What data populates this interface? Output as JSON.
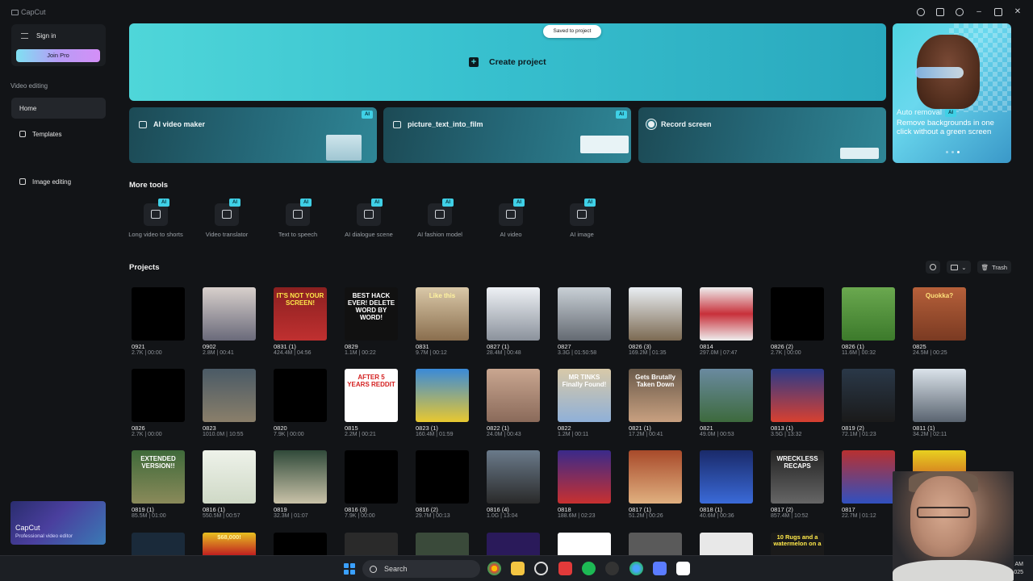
{
  "window": {
    "app_name": "CapCut"
  },
  "sidebar": {
    "sign_in": "Sign in",
    "join_pro": "Join Pro",
    "section_video": "Video editing",
    "items": [
      {
        "label": "Home"
      },
      {
        "label": "Templates"
      }
    ],
    "image_editing": "Image editing",
    "promo": {
      "title": "CapCut",
      "subtitle": "Professional video editor"
    }
  },
  "main": {
    "toast": "Saved to project",
    "create_project": "Create project",
    "features": [
      {
        "label": "AI video maker",
        "badge": "AI"
      },
      {
        "label": "picture_text_into_film",
        "badge": "AI"
      },
      {
        "label": "Record screen"
      }
    ],
    "hero": {
      "title": "Auto removal",
      "badge": "AI",
      "text": "Remove backgrounds in one click without a green screen"
    },
    "more_tools_title": "More tools",
    "tools": [
      {
        "label": "Long video to shorts",
        "badge": "AI",
        "icon": "film-icon"
      },
      {
        "label": "Video translator",
        "badge": "AI",
        "icon": "translate-icon"
      },
      {
        "label": "Text to speech",
        "badge": "AI",
        "icon": "speech-icon"
      },
      {
        "label": "AI dialogue scene",
        "badge": "AI",
        "icon": "dialogue-icon"
      },
      {
        "label": "AI fashion model",
        "badge": "AI",
        "icon": "shirt-icon"
      },
      {
        "label": "AI video",
        "badge": "AI",
        "icon": "video-icon"
      },
      {
        "label": "AI image",
        "badge": "AI",
        "icon": "image-icon"
      }
    ],
    "projects_title": "Projects",
    "trash": "Trash",
    "projects": [
      {
        "name": "0921",
        "meta": "2.7K | 00:00"
      },
      {
        "name": "0902",
        "meta": "2.8M | 00:41"
      },
      {
        "name": "0831 (1)",
        "meta": "424.4M | 04:56",
        "caption": "IT'S NOT YOUR SCREEN!"
      },
      {
        "name": "0829",
        "meta": "1.1M | 00:22",
        "caption": "BEST HACK EVER! DELETE WORD BY WORD!"
      },
      {
        "name": "0831",
        "meta": "9.7M | 00:12",
        "caption": "Like this"
      },
      {
        "name": "0827 (1)",
        "meta": "28.4M | 00:48"
      },
      {
        "name": "0827",
        "meta": "3.3G | 01:50:58"
      },
      {
        "name": "0826 (3)",
        "meta": "169.2M | 01:35"
      },
      {
        "name": "0814",
        "meta": "297.0M | 07:47"
      },
      {
        "name": "0826 (2)",
        "meta": "2.7K | 00:00"
      },
      {
        "name": "0826 (1)",
        "meta": "11.6M | 00:32"
      },
      {
        "name": "0825",
        "meta": "24.5M | 00:25",
        "caption": "Quokka?"
      },
      {
        "name": "0826",
        "meta": "2.7K | 00:00"
      },
      {
        "name": "0823",
        "meta": "1010.0M | 10:55"
      },
      {
        "name": "0820",
        "meta": "7.9K | 00:00"
      },
      {
        "name": "0815",
        "meta": "2.2M | 00:21",
        "caption": "AFTER 5 YEARS REDDIT"
      },
      {
        "name": "0823 (1)",
        "meta": "160.4M | 01:59"
      },
      {
        "name": "0822 (1)",
        "meta": "24.0M | 00:43"
      },
      {
        "name": "0822",
        "meta": "1.2M | 00:11",
        "caption": "MR TINKS Finally Found!"
      },
      {
        "name": "0821 (1)",
        "meta": "17.2M | 00:41",
        "caption": "Gets Brutally Taken Down"
      },
      {
        "name": "0821",
        "meta": "49.0M | 00:53"
      },
      {
        "name": "0813 (1)",
        "meta": "3.5G | 13:32"
      },
      {
        "name": "0819 (2)",
        "meta": "72.1M | 01:23"
      },
      {
        "name": "0811 (1)",
        "meta": "34.2M | 02:11"
      },
      {
        "name": "0819 (1)",
        "meta": "85.5M | 01:00",
        "caption": "EXTENDED VERSION!!"
      },
      {
        "name": "0816 (1)",
        "meta": "550.5M | 00:57"
      },
      {
        "name": "0819",
        "meta": "32.3M | 01:07"
      },
      {
        "name": "0816 (3)",
        "meta": "7.9K | 00:00"
      },
      {
        "name": "0816 (2)",
        "meta": "29.7M | 00:13"
      },
      {
        "name": "0816 (4)",
        "meta": "1.0G | 13:04"
      },
      {
        "name": "0818",
        "meta": "188.6M | 02:23"
      },
      {
        "name": "0817 (1)",
        "meta": "51.2M | 00:26"
      },
      {
        "name": "0818 (1)",
        "meta": "40.6M | 00:36"
      },
      {
        "name": "0817 (2)",
        "meta": "857.4M | 10:52",
        "caption": "WRECKLESS RECAPS"
      },
      {
        "name": "0817",
        "meta": "22.7M | 01:12"
      },
      {
        "name": "",
        "meta": ""
      }
    ],
    "partial_row_captions": [
      "$68,000!",
      "10 Rugs and a watermelon on a"
    ]
  },
  "taskbar": {
    "search": "Search",
    "time": "AM",
    "date": "025"
  },
  "colors": {
    "accent": "#3fd0e6",
    "create_bg": "#38c1cf",
    "bg": "#121417"
  }
}
